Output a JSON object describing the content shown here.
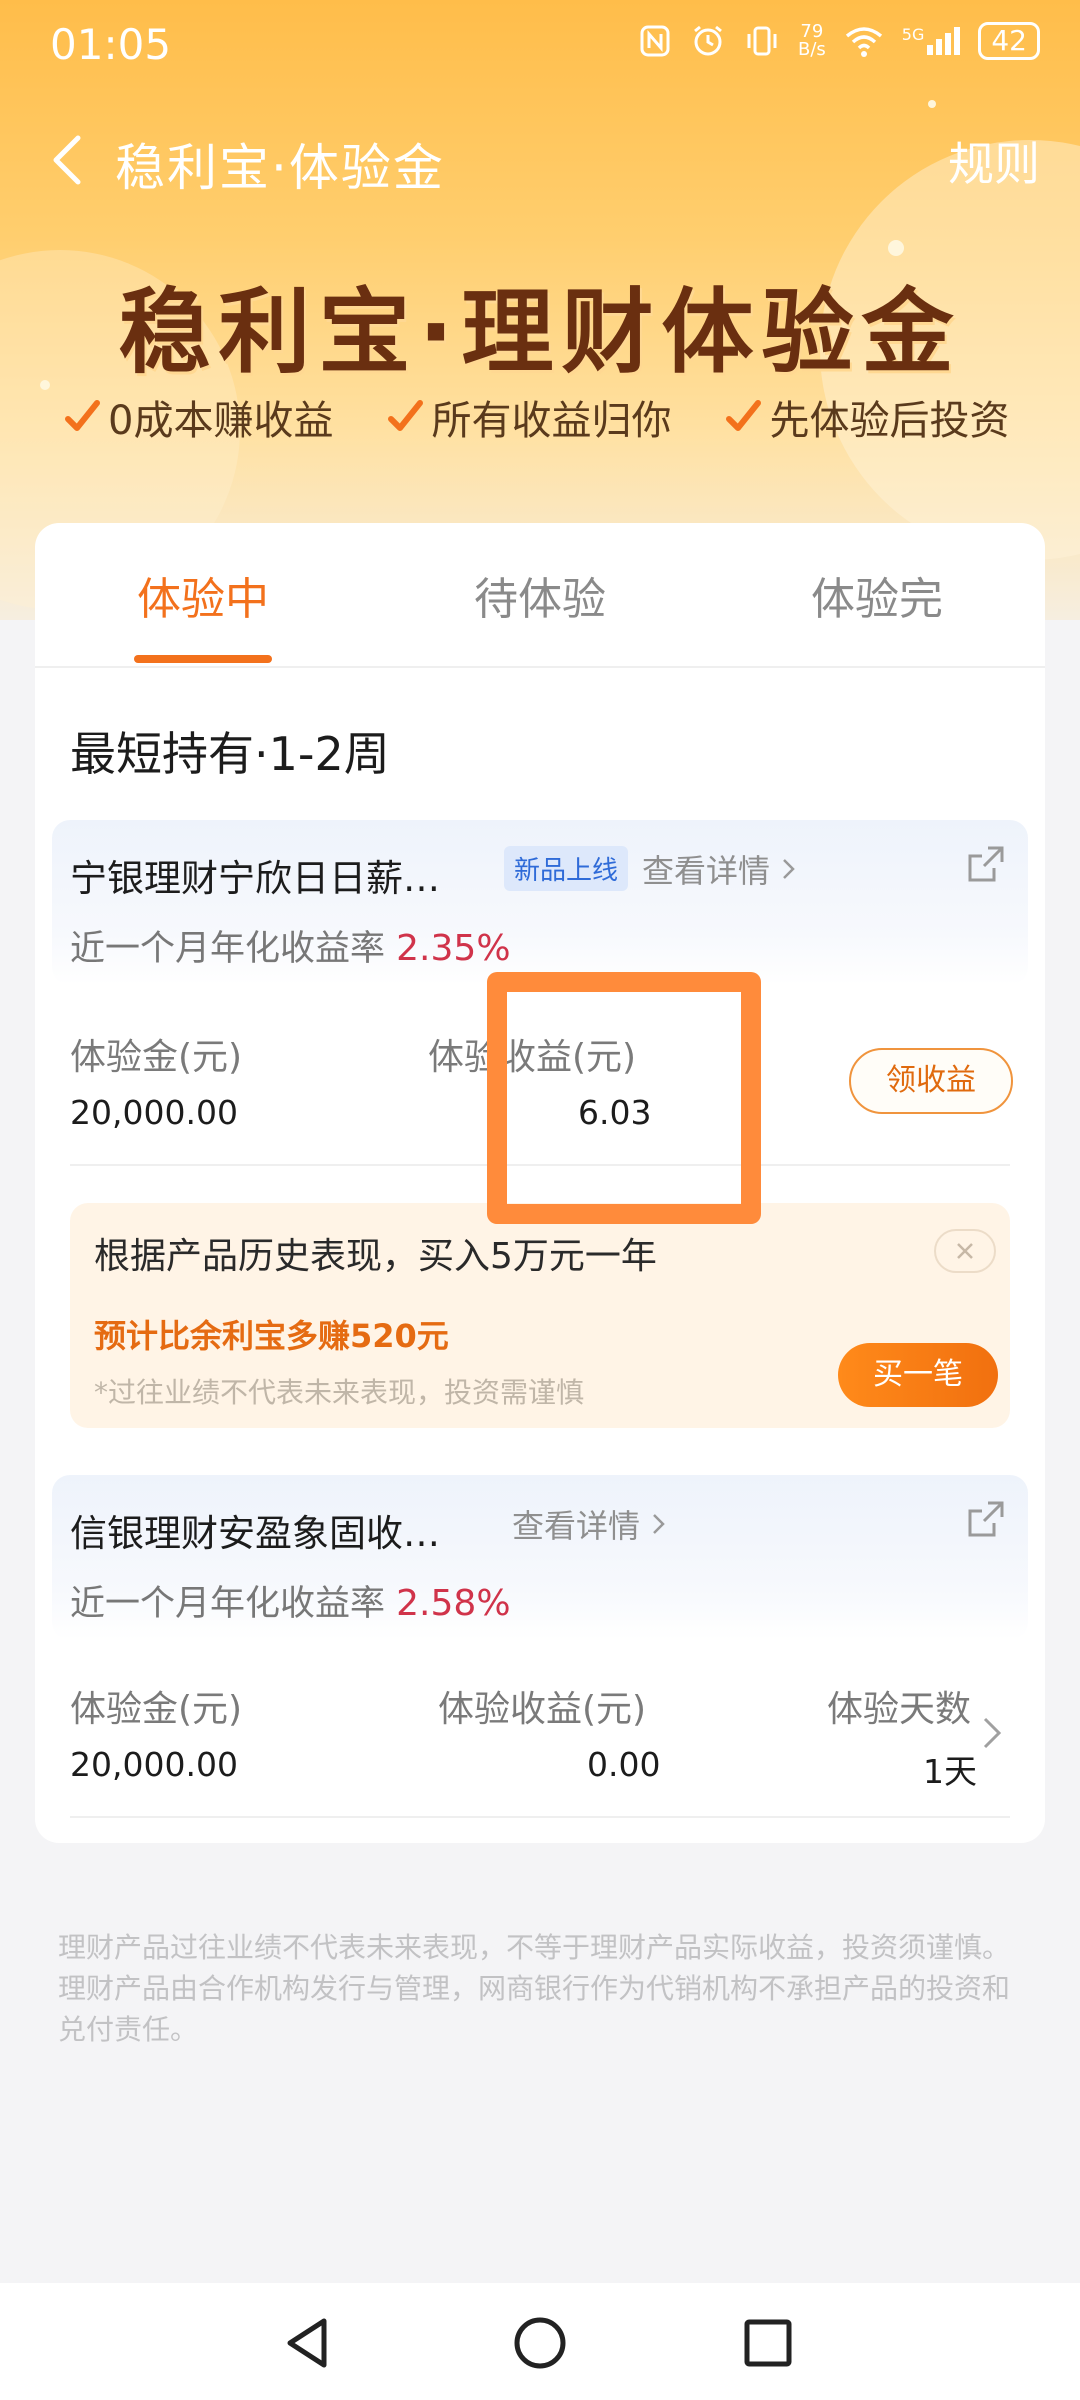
{
  "status_bar": {
    "time": "01:05",
    "net_speed_value": "79",
    "net_speed_unit": "B/s",
    "network": "5G",
    "battery": "42"
  },
  "header": {
    "title": "稳利宝·体验金",
    "rules_label": "规则"
  },
  "banner": {
    "title": "稳利宝·理财体验金",
    "features": [
      "0成本赚收益",
      "所有收益归你",
      "先体验后投资"
    ]
  },
  "tabs": [
    {
      "label": "体验中",
      "active": true
    },
    {
      "label": "待体验",
      "active": false
    },
    {
      "label": "体验完",
      "active": false
    }
  ],
  "section_title": "最短持有·1-2周",
  "products": [
    {
      "name": "宁银理财宁欣日日薪…",
      "badge": "新品上线",
      "detail_label": "查看详情",
      "rate_label": "近一个月年化收益率",
      "rate": "2.35%",
      "fund_label": "体验金(元)",
      "fund_value": "20,000.00",
      "earn_label": "体验收益(元)",
      "earn_value": "6.03",
      "claim_label": "领收益"
    },
    {
      "name": "信银理财安盈象固收…",
      "detail_label": "查看详情",
      "rate_label": "近一个月年化收益率",
      "rate": "2.58%",
      "fund_label": "体验金(元)",
      "fund_value": "20,000.00",
      "earn_label": "体验收益(元)",
      "earn_value": "0.00",
      "days_label": "体验天数",
      "days_value": "1天"
    }
  ],
  "promo": {
    "text": "根据产品历史表现，买入5万元一年",
    "earn": "预计比余利宝多赚520元",
    "note": "*过往业绩不代表未来表现，投资需谨慎",
    "buy_label": "买一笔"
  },
  "disclaimer": "理财产品过往业绩不代表未来表现，不等于理财产品实际收益，投资须谨慎。理财产品由合作机构发行与管理，网商银行作为代销机构不承担产品的投资和兑付责任。",
  "colors": {
    "accent": "#f3711c",
    "rate": "#d0334a",
    "highlight_box": "#ff8b3b"
  },
  "icons": [
    "back-icon",
    "check-icon",
    "share-icon",
    "chevron-right-icon",
    "close-icon",
    "nfc-icon",
    "alarm-icon",
    "vibrate-icon",
    "wifi-icon",
    "signal-icon"
  ]
}
